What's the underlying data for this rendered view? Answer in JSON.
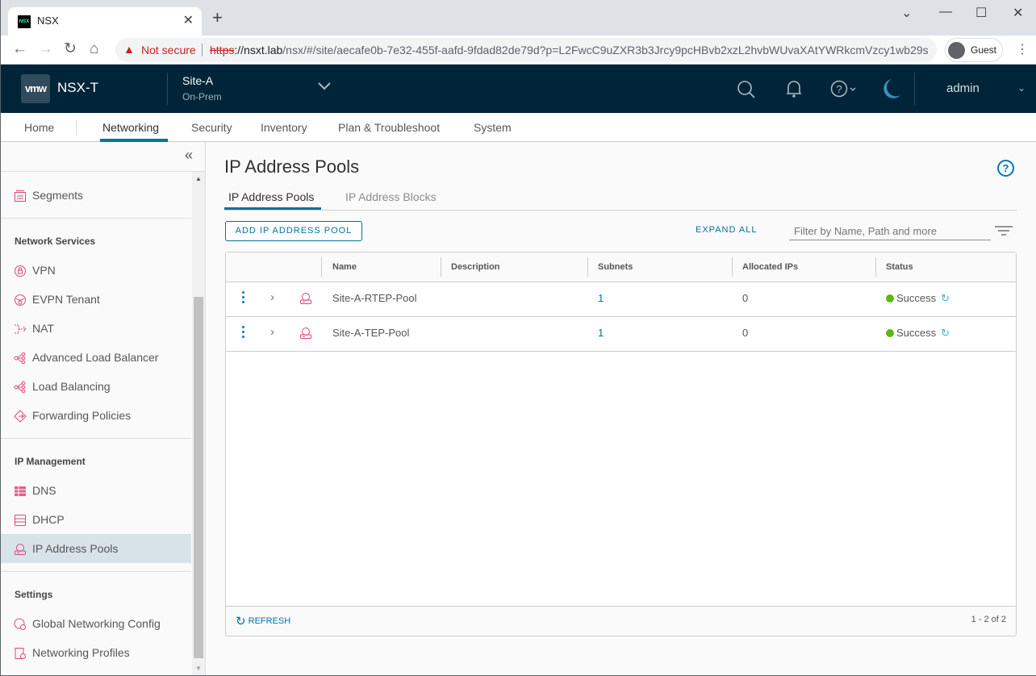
{
  "browser": {
    "tab_title": "NSX",
    "tab_favicon": "NSX",
    "new_tab": "+",
    "security_label": "Not secure",
    "url_scheme": "https",
    "url_host": "://nsxt.lab",
    "url_rest": "/nsx/#/site/aecafe0b-7e32-455f-aafd-9fdad82de79d?p=L2FwcC9uZXR3b3Jrcy9pcHBvb2xzL2hvbWUvaXAtYWRkcmVzcy1wb29s...",
    "profile_label": "Guest"
  },
  "header": {
    "logo": "vmw",
    "product": "NSX-T",
    "site_name": "Site-A",
    "site_type": "On-Prem",
    "user": "admin",
    "icons": [
      "search-icon",
      "bell-icon",
      "help-icon",
      "moon-icon"
    ]
  },
  "nav": {
    "items": [
      {
        "label": "Home"
      },
      {
        "label": "Networking",
        "active": true
      },
      {
        "label": "Security"
      },
      {
        "label": "Inventory"
      },
      {
        "label": "Plan & Troubleshoot"
      },
      {
        "label": "System"
      }
    ]
  },
  "sidebar": {
    "top_items": [
      {
        "label": "Segments",
        "icon": "segments-icon"
      }
    ],
    "sections": [
      {
        "title": "Network Services",
        "items": [
          {
            "label": "VPN",
            "icon": "vpn-icon"
          },
          {
            "label": "EVPN Tenant",
            "icon": "evpn-icon"
          },
          {
            "label": "NAT",
            "icon": "nat-icon"
          },
          {
            "label": "Advanced Load Balancer",
            "icon": "load-balancer-icon"
          },
          {
            "label": "Load Balancing",
            "icon": "load-balancer-icon"
          },
          {
            "label": "Forwarding Policies",
            "icon": "forwarding-icon"
          }
        ]
      },
      {
        "title": "IP Management",
        "items": [
          {
            "label": "DNS",
            "icon": "dns-icon"
          },
          {
            "label": "DHCP",
            "icon": "dhcp-icon"
          },
          {
            "label": "IP Address Pools",
            "icon": "ip-pool-icon",
            "active": true
          }
        ]
      },
      {
        "title": "Settings",
        "items": [
          {
            "label": "Global Networking Config",
            "icon": "global-config-icon"
          },
          {
            "label": "Networking Profiles",
            "icon": "profiles-icon"
          }
        ]
      }
    ]
  },
  "main": {
    "title": "IP Address Pools",
    "tabs": [
      {
        "label": "IP Address Pools",
        "active": true
      },
      {
        "label": "IP Address Blocks"
      }
    ],
    "add_button": "ADD IP ADDRESS POOL",
    "expand_all": "EXPAND ALL",
    "filter_placeholder": "Filter by Name, Path and more",
    "columns": [
      "Name",
      "Description",
      "Subnets",
      "Allocated IPs",
      "Status"
    ],
    "rows": [
      {
        "name": "Site-A-RTEP-Pool",
        "description": "",
        "subnets": "1",
        "allocated": "0",
        "status": "Success"
      },
      {
        "name": "Site-A-TEP-Pool",
        "description": "",
        "subnets": "1",
        "allocated": "0",
        "status": "Success"
      }
    ],
    "refresh": "REFRESH",
    "pagination": "1 - 2 of 2"
  },
  "colors": {
    "accent": "#0072a3",
    "header_bg": "#002538",
    "success": "#60b515",
    "icon_pink": "#e0457b"
  }
}
